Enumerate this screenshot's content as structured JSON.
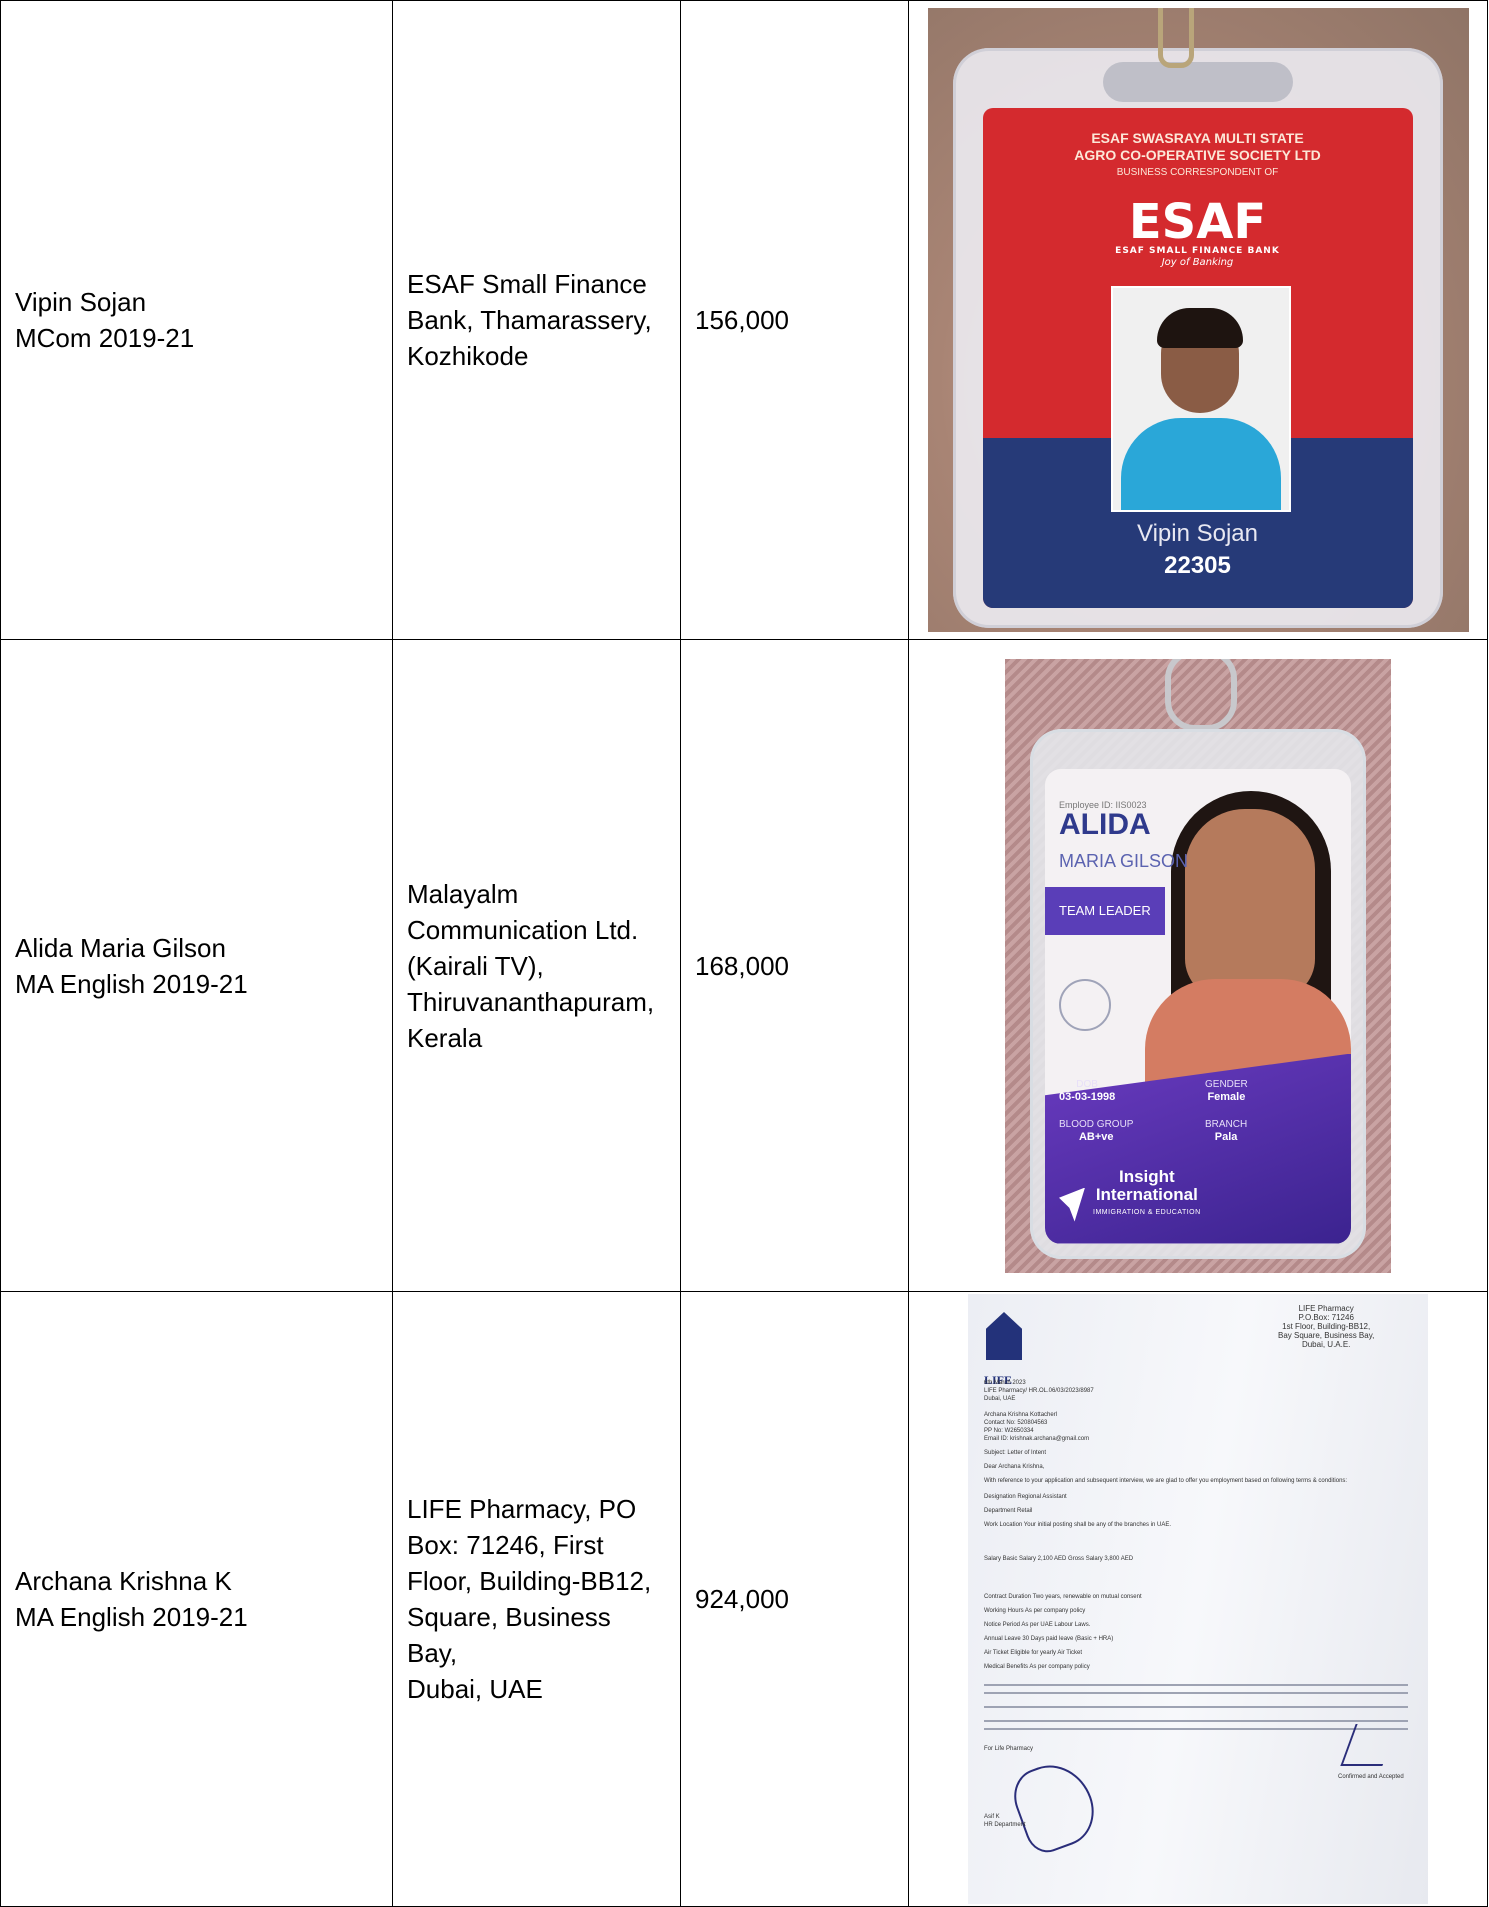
{
  "rows": [
    {
      "student_line1": "Vipin Sojan",
      "student_line2": "MCom 2019-21",
      "employer_lines": [
        "ESAF Small Finance",
        "Bank, Thamarassery,",
        "Kozhikode"
      ],
      "package": "156,000",
      "photo": {
        "card_header": [
          "ESAF SWASRAYA MULTI STATE",
          "AGRO CO-OPERATIVE SOCIETY LTD"
        ],
        "card_header_sub": "BUSINESS CORRESPONDENT OF",
        "logo": "ESAF",
        "logo_sub": "ESAF SMALL FINANCE BANK",
        "logo_tag": "Joy of Banking",
        "name": "Vipin Sojan",
        "number": "22305"
      }
    },
    {
      "student_line1": "Alida Maria Gilson",
      "student_line2": "MA English 2019-21",
      "employer_lines": [
        "Malayalm",
        "Communication Ltd.",
        "(Kairali TV),",
        "Thiruvananthapuram,",
        "Kerala"
      ],
      "package": "168,000",
      "photo": {
        "employee_id": "Employee ID: IIS0023",
        "first_name": "ALIDA",
        "last_name": "MARIA GILSON",
        "role": "TEAM LEADER",
        "dob_label": "DOB",
        "dob": "03-03-1998",
        "gender_label": "GENDER",
        "gender": "Female",
        "blood_label": "BLOOD GROUP",
        "blood": "AB+ve",
        "branch_label": "BRANCH",
        "branch": "Pala",
        "brand_line1": "Insight",
        "brand_line2": "International",
        "brand_sub": "IMMIGRATION & EDUCATION"
      }
    },
    {
      "student_line1": "Archana Krishna K",
      "student_line2": "MA English 2019-21",
      "employer_lines": [
        "LIFE Pharmacy, PO",
        "Box: 71246, First",
        "Floor, Building-BB12,",
        "Square, Business Bay,",
        "Dubai, UAE"
      ],
      "package": "924,000",
      "photo": {
        "logo": "LIFE",
        "address": [
          "LIFE Pharmacy",
          "P.O.Box: 71246",
          "1st Floor, Building-BB12,",
          "Bay Square, Business Bay,",
          "Dubai, U.A.E."
        ],
        "lines": [
          "6th March 2023",
          "LIFE Pharmacy/ HR.OL.06/03/2023/8987",
          "Dubai, UAE",
          "Archana Krishna Kottacherl",
          "Contact No: 520804563",
          "PP No: W2650334",
          "Email ID: krishnak.archana@gmail.com",
          "Subject: Letter of Intent",
          "Dear Archana Krishna,",
          "With reference to your application and subsequent interview, we are glad to offer you employment based on following terms & conditions:",
          "Designation          Regional Assistant",
          "Department          Retail",
          "Work Location       Your initial posting shall be any of the branches in UAE.",
          "Salary              Basic Salary 2,100 AED  Gross Salary 3,800 AED",
          "Contract Duration   Two years, renewable on mutual consent",
          "Working Hours       As per company policy",
          "Notice Period       As per UAE Labour Laws.",
          "Annual Leave        30 Days paid leave (Basic + HRA)",
          "Air Ticket          Eligible for yearly Air Ticket",
          "Medical Benefits    As per company policy",
          "For Life Pharmacy",
          "Asif K",
          "HR Department"
        ],
        "accepted": "Confirmed and Accepted"
      }
    }
  ]
}
